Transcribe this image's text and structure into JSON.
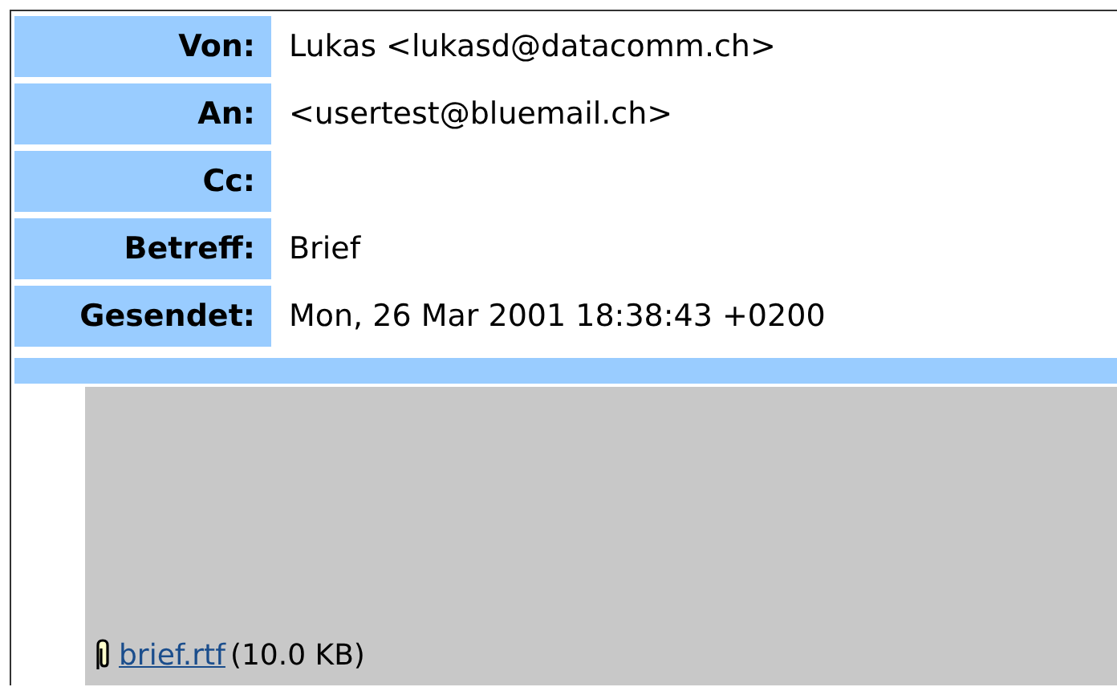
{
  "headers": [
    {
      "label": "Von:",
      "value": "Lukas <lukasd@datacomm.ch>"
    },
    {
      "label": "An:",
      "value": "<usertest@bluemail.ch>"
    },
    {
      "label": "Cc:"
    },
    {
      "label": "Betreff:",
      "value": "Brief"
    },
    {
      "label": "Gesendet:",
      "value": "Mon, 26 Mar 2001 18:38:43 +0200"
    }
  ],
  "attachment": {
    "name": "brief.rtf",
    "size": "(10.0 KB)"
  }
}
